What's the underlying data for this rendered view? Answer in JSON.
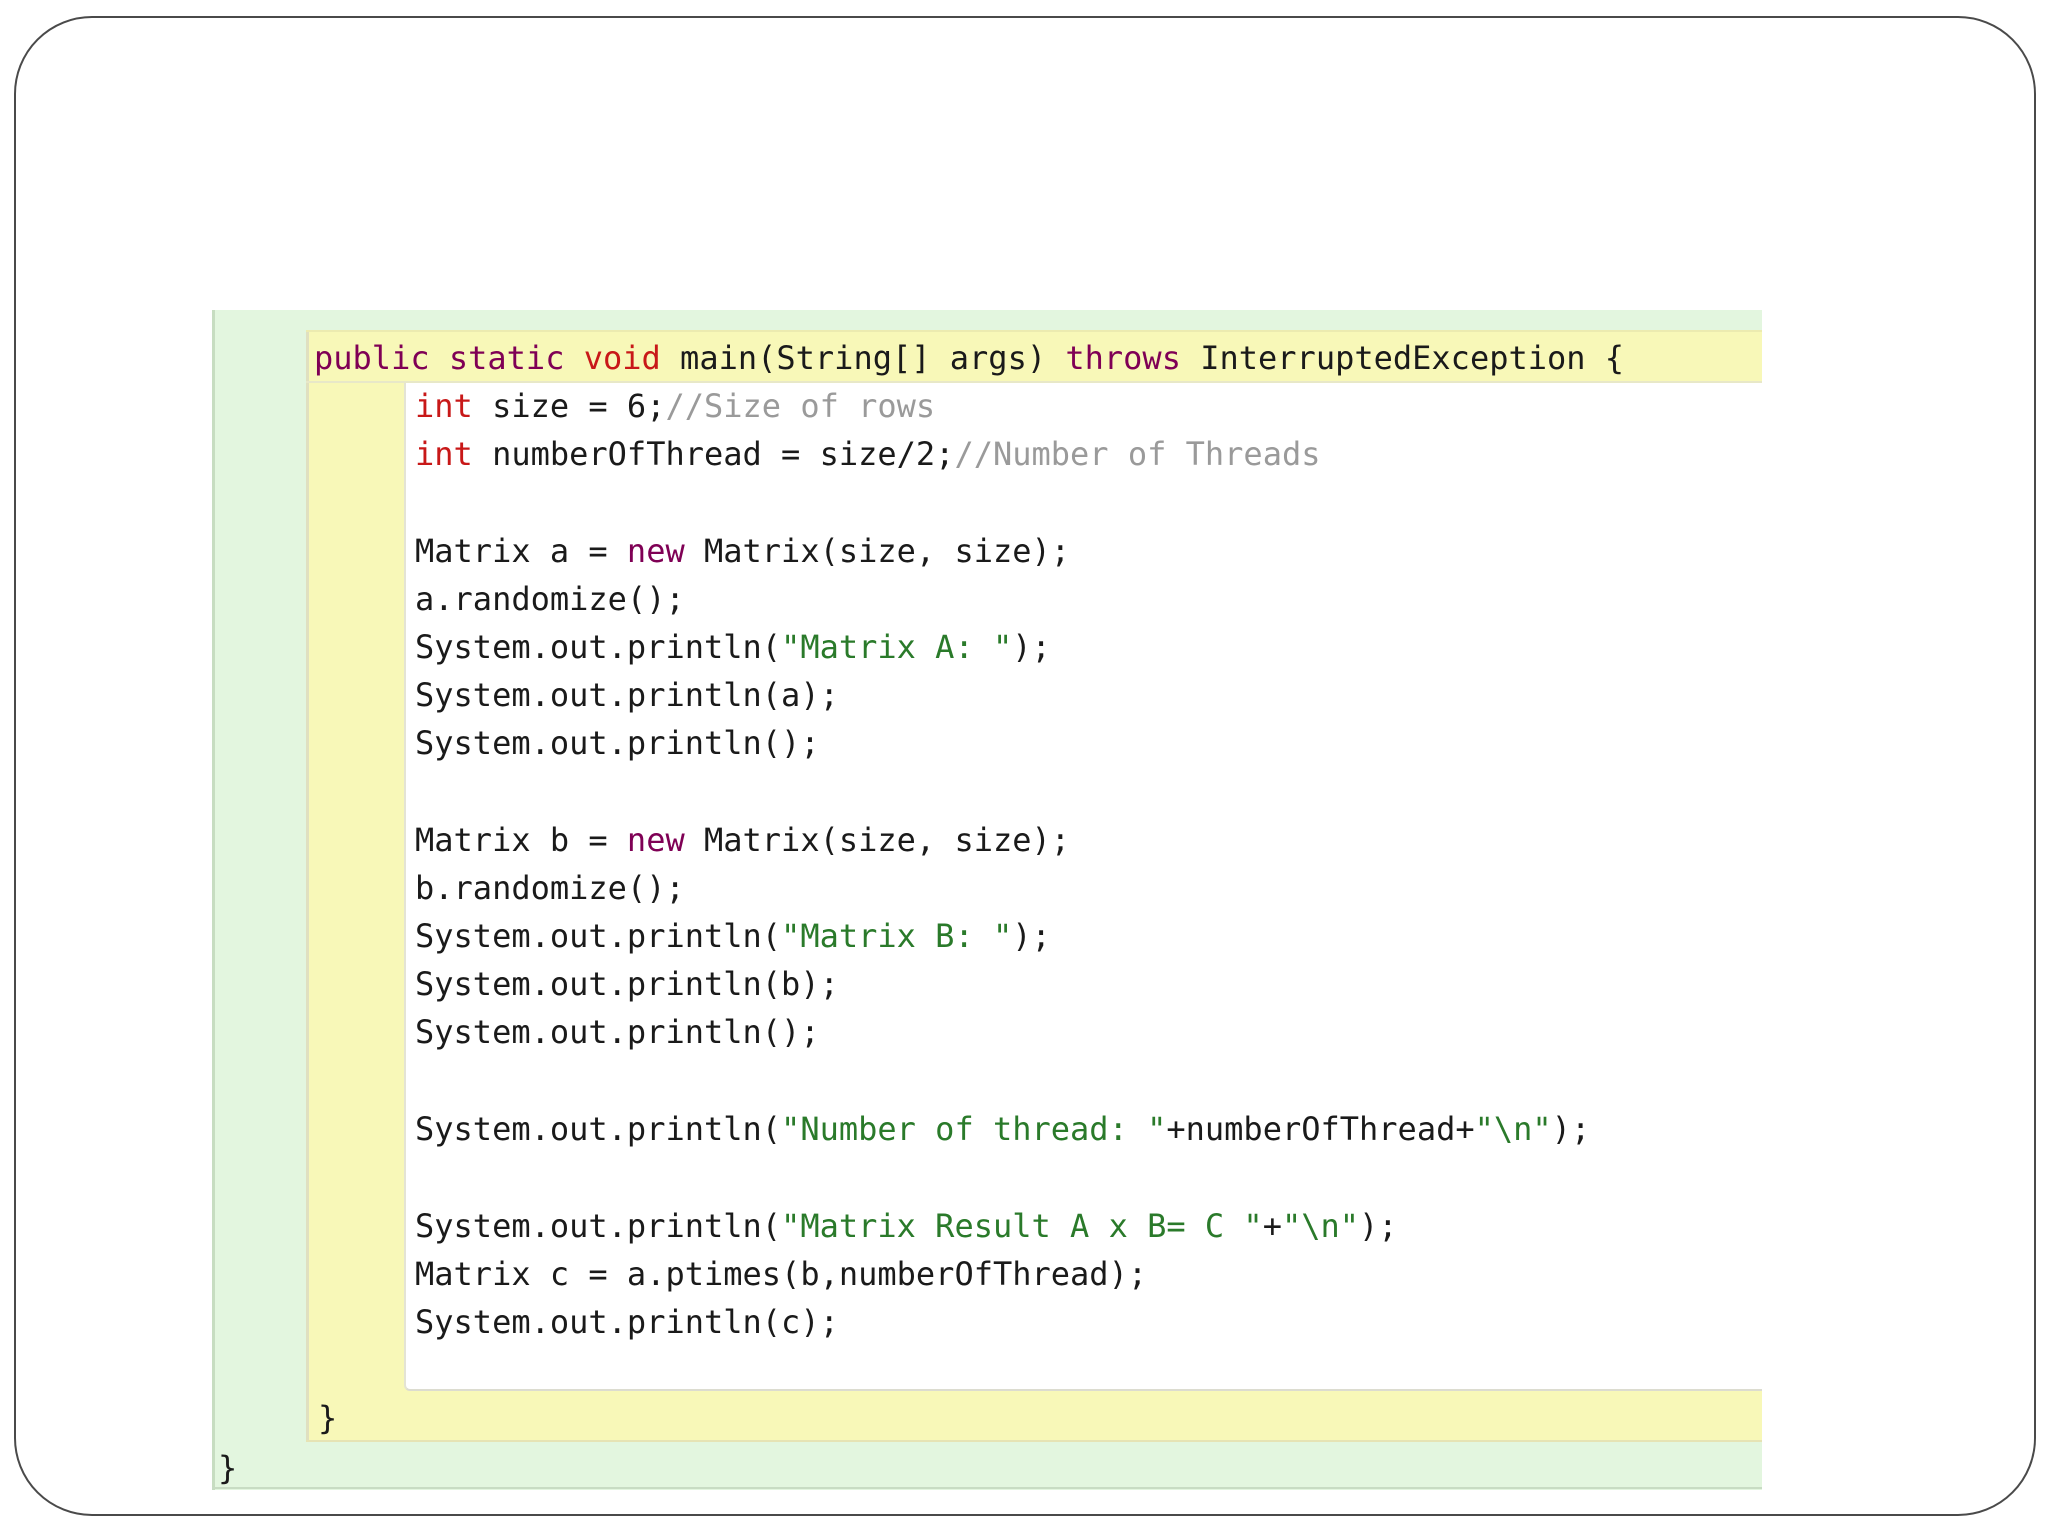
{
  "code": {
    "method_signature": {
      "kw_public": "public",
      "kw_static": "static",
      "kw_void": "void",
      "name_args": "main(String[] args)",
      "kw_throws": "throws",
      "exception": "InterruptedException {"
    },
    "line_size": {
      "kw": "int",
      "code": "size = 6;",
      "comment": "//Size of rows"
    },
    "line_threads": {
      "kw": "int",
      "code": "numberOfThread = size/2;",
      "comment": "//Number of Threads"
    },
    "line_matrix_a": {
      "pre": "Matrix a = ",
      "kw": "new",
      "post": "Matrix(size, size);"
    },
    "line_randomize_a": "a.randomize();",
    "line_print_a_label": {
      "pre": "System.out.println(",
      "str": "\"Matrix A: \"",
      "post": ");"
    },
    "line_print_a": "System.out.println(a);",
    "line_println_1": "System.out.println();",
    "line_matrix_b": {
      "pre": "Matrix b = ",
      "kw": "new",
      "post": "Matrix(size, size);"
    },
    "line_randomize_b": "b.randomize();",
    "line_print_b_label": {
      "pre": "System.out.println(",
      "str": "\"Matrix B: \"",
      "post": ");"
    },
    "line_print_b": "System.out.println(b);",
    "line_println_2": "System.out.println();",
    "line_print_threads": {
      "pre": "System.out.println(",
      "str1": "\"Number of thread: \"",
      "mid": "+numberOfThread+",
      "str2": "\"\\n\"",
      "post": ");"
    },
    "line_print_result": {
      "pre": "System.out.println(",
      "str1": "\"Matrix Result A x B= C \"",
      "mid": "+",
      "str2": "\"\\n\"",
      "post": ");"
    },
    "line_matrix_c": "Matrix c = a.ptimes(b,numberOfThread);",
    "line_print_c": "System.out.println(c);",
    "method_close": "}",
    "class_close": "}"
  },
  "colors": {
    "keyword": "#7f0055",
    "keyword_red": "#c81818",
    "string": "#2a7a2a",
    "comment": "#9a9a9a",
    "class_scope_bg": "#e3f6df",
    "method_scope_bg": "#f8f8b8"
  }
}
